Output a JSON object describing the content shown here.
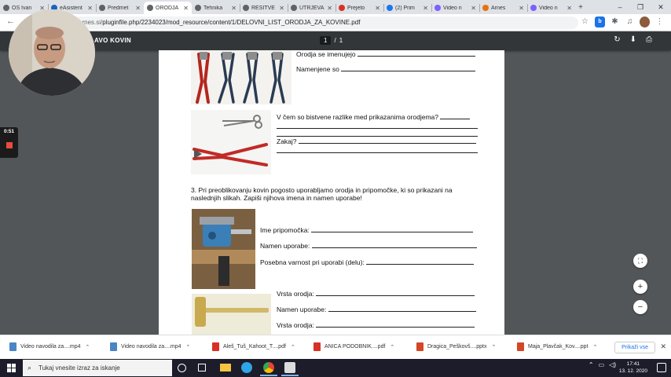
{
  "tabs": [
    {
      "label": "OŠ Ivan",
      "color": "#5f6368"
    },
    {
      "label": "eAsistent",
      "color": "#1565c0"
    },
    {
      "label": "Predmet",
      "color": "#5f6368"
    },
    {
      "label": "ORODJA",
      "color": "#5f6368",
      "active": true
    },
    {
      "label": "Tehnika",
      "color": "#5f6368"
    },
    {
      "label": "REŠITVE",
      "color": "#5f6368"
    },
    {
      "label": "UTRJEVA",
      "color": "#5f6368"
    },
    {
      "label": "Prejeto",
      "color": "#d93025"
    },
    {
      "label": "(2) Prim",
      "color": "#1877f2"
    },
    {
      "label": "Video n",
      "color": "#7b61ff"
    },
    {
      "label": "Arnes",
      "color": "#e8710a"
    },
    {
      "label": "Video n",
      "color": "#7b61ff"
    }
  ],
  "new_tab": "+",
  "window_controls": {
    "minimize": "–",
    "maximize": "❐",
    "close": "✕"
  },
  "address": {
    "back": "←",
    "url_dim": "arnes.si/",
    "url_main": "pluginfile.php/2234023/mod_resource/content/1/DELOVNI_LIST_ORODJA_ZA_KOVINE.pdf"
  },
  "pdf": {
    "title": "AVO KOVIN",
    "page_current": "1",
    "page_sep": "/",
    "page_total": "1",
    "rotate": "↻",
    "download": "⬇",
    "print": "⎙"
  },
  "worksheet": {
    "q_named": "Orodja se imenujejo",
    "q_purpose": "Namenjene so",
    "q_difference": "V čem so bistvene razlike med prikazanima orodjema?",
    "q_why": "Zakaj?",
    "q3_line1": "3. Pri preoblikovanju kovin pogosto uporabljamo orodja in pripomočke, ki so prikazani na",
    "q3_line2": "naslednjih slikah. Zapiši njihova imena in namen uporabe!",
    "tool_name": "Ime pripomočka:",
    "tool_use": "Namen uporabe:",
    "tool_caution": "Posebna varnost pri uporabi (delu):",
    "type_a": "Vrsta orodja:",
    "use_a": "Namen uporabe:",
    "type_b": "Vrsta orodja:"
  },
  "timer": "0:51",
  "zoom": {
    "fit": "⛶",
    "in": "+",
    "out": "−"
  },
  "downloads": [
    {
      "label": "Video navodila za....mp4",
      "color": "#4a86c5"
    },
    {
      "label": "Video navodila za....mp4",
      "color": "#4a86c5"
    },
    {
      "label": "Aleš_Tuš_Kahoot_T....pdf",
      "color": "#d93025"
    },
    {
      "label": "ANICA PODOBNIK....pdf",
      "color": "#d93025"
    },
    {
      "label": "Dragica_Peškovš....pptx",
      "color": "#d24726"
    },
    {
      "label": "Maja_Plavčak_Kov....ppt",
      "color": "#d24726"
    }
  ],
  "show_all": "Prikaži vse",
  "dl_close": "✕",
  "taskbar": {
    "search_placeholder": "Tukaj vnesite izraz za iskanje",
    "time": "17:41",
    "date": "13. 12. 2020"
  }
}
